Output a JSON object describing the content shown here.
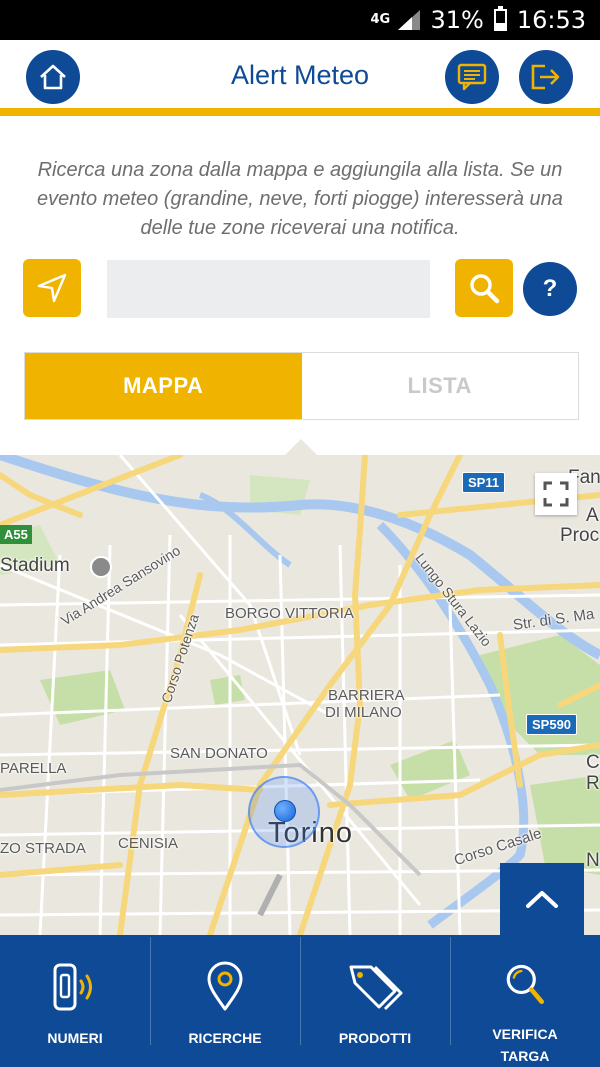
{
  "status_bar": {
    "network": "4G",
    "battery_percent": "31%",
    "battery_level": 0.31,
    "time": "16:53"
  },
  "header": {
    "title": "Alert Meteo",
    "icons": {
      "home": "home-icon",
      "chat": "message-icon",
      "exit": "logout-icon"
    }
  },
  "intro": {
    "text": "Ricerca una zona dalla mappa e aggiungila alla lista. Se un evento meteo (grandine, neve, forti piogge) interesserà una delle tue zone riceverai una notifica."
  },
  "search": {
    "value": "",
    "placeholder": "",
    "help_label": "?"
  },
  "tabs": [
    {
      "label": "MAPPA",
      "active": true
    },
    {
      "label": "LISTA",
      "active": false
    }
  ],
  "map": {
    "city": "Torino",
    "labels": {
      "stadium": "Stadium",
      "borgo_vittoria": "BORGO VITTORIA",
      "barriera_1": "BARRIERA",
      "barriera_2": "DI MILANO",
      "san_donato": "SAN DONATO",
      "parella": "PARELLA",
      "cenisia": "CENISIA",
      "zo_strada": "ZO STRADA",
      "via_sansovino": "Via Andrea Sansovino",
      "corso_potenza": "Corso Potenza",
      "lungo_stura": "Lungo Stura Lazio",
      "str_di_s_ma": "Str. di S. Ma",
      "corso_casale": "Corso Casale",
      "edge_fan": "Fan",
      "edge_a": "A",
      "edge_proc": "Proc",
      "edge_c": "C",
      "edge_r": "R",
      "edge_n": "N"
    },
    "shields": {
      "sp11": "SP11",
      "sp590": "SP590",
      "a55": "A55"
    }
  },
  "bottom_nav": [
    {
      "label": "NUMERI",
      "icon": "phone-icon"
    },
    {
      "label": "RICERCHE",
      "icon": "location-pin-icon"
    },
    {
      "label": "PRODOTTI",
      "icon": "tag-icon"
    },
    {
      "label": "VERIFICA TARGA",
      "icon": "magnifier-icon"
    }
  ],
  "colors": {
    "primary": "#0e4a96",
    "accent": "#f0b400",
    "map_bg": "#eae7df"
  }
}
